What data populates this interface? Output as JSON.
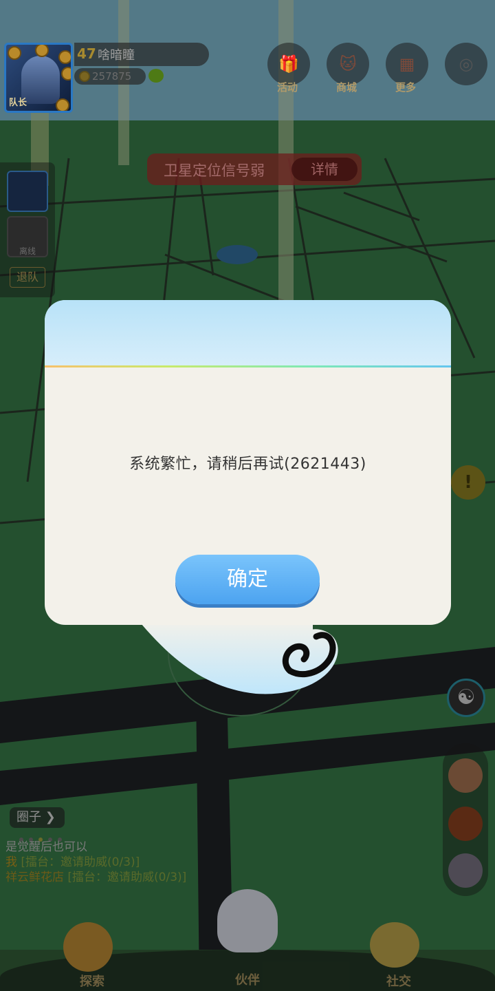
{
  "player": {
    "level": "47",
    "name": "啥暗瞳",
    "coins": "257875",
    "team_tag": "队长"
  },
  "top_menu": [
    {
      "label": "活动",
      "icon": "gift-icon"
    },
    {
      "label": "商城",
      "icon": "shop-cat-icon"
    },
    {
      "label": "更多",
      "icon": "grid-icon"
    },
    {
      "label": "",
      "icon": "compass-icon"
    }
  ],
  "notice": {
    "text": "卫星定位信号弱",
    "detail_label": "详情"
  },
  "team_panel": {
    "offline_label": "离线",
    "leave_label": "退队"
  },
  "circle_button": "圈子",
  "feed": {
    "line1": "是觉醒后也可以",
    "line2_who": "我",
    "line2_body": "[擂台：邀请助威(0/3)]",
    "line3_who": "祥云鲜花店",
    "line3_body": "[擂台：邀请助威(0/3)]"
  },
  "bottom_nav": {
    "explore": "探索",
    "partner": "伙伴",
    "social": "社交"
  },
  "dialog": {
    "message": "系统繁忙，请稍后再试(2621443)",
    "confirm_label": "确定"
  },
  "colors": {
    "dialog_bg": "#f3f1ea",
    "dialog_header": "#c9e9f9",
    "confirm_button": "#5aaef3"
  }
}
